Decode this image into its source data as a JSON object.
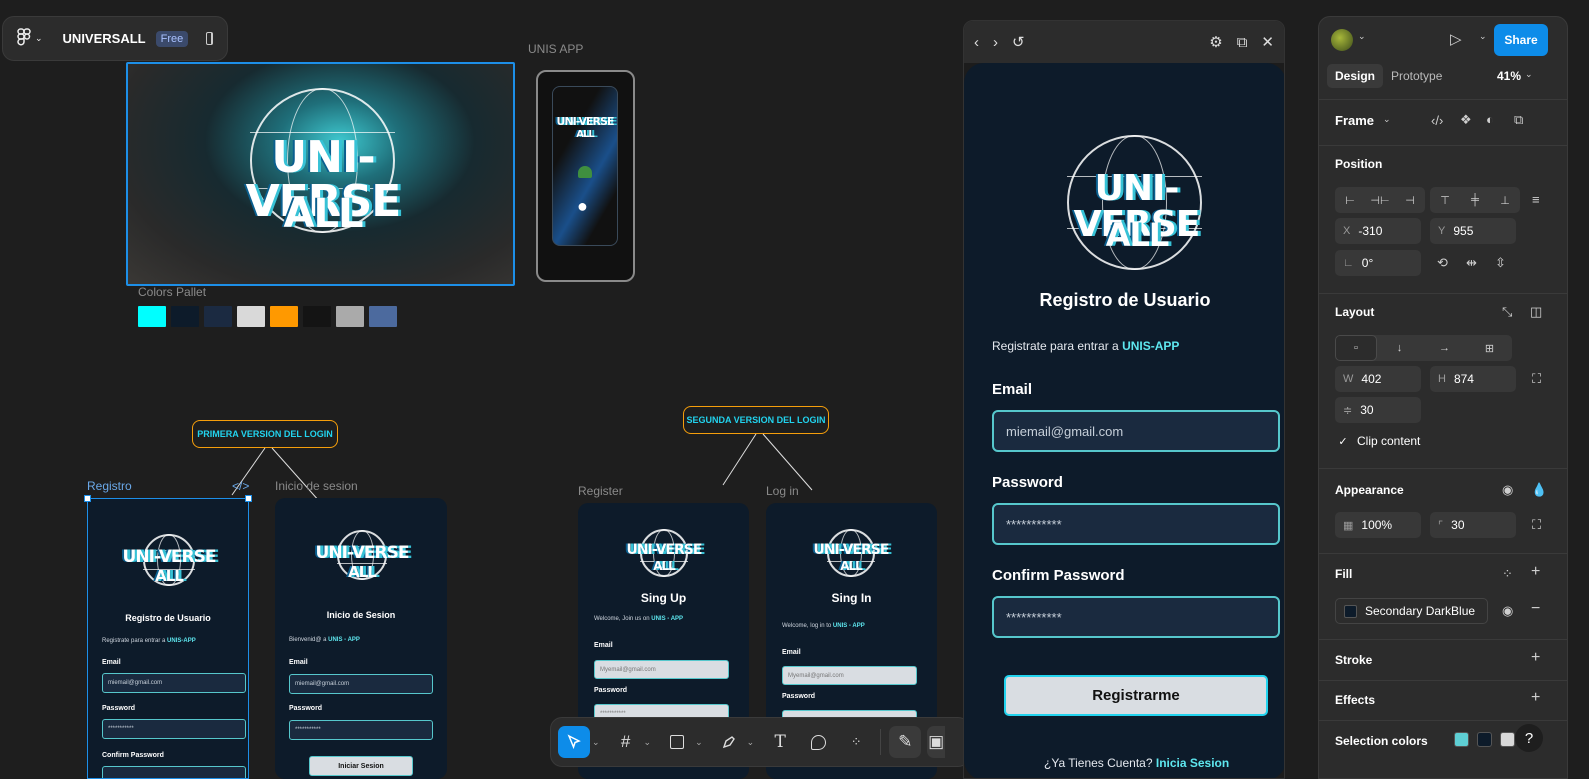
{
  "menu": {
    "project_name": "UNIVERSALL",
    "plan_badge": "Free"
  },
  "canvas": {
    "hero_brand_line1": "UNI-VERSE",
    "hero_brand_line2": "ALL",
    "phone_label": "UNIS APP",
    "colors_label": "Colors Pallet",
    "palette": [
      "#00ffff",
      "#0d1b2a",
      "#1b2a41",
      "#d9d9d9",
      "#ff9900",
      "#141414",
      "#aaaaaa",
      "#4c6a9e"
    ],
    "callout1": "PRIMERA VERSION DEL LOGIN",
    "callout2": "SEGUNDA VERSION DEL LOGIN",
    "frame_registro": "Registro",
    "frame_inicio": "Inicio de sesion",
    "frame_register": "Register",
    "frame_login": "Log in",
    "code_icon": "</>",
    "registro_screen": {
      "title": "Registro de Usuario",
      "subtitle": "Registrate para entrar a",
      "app": "UNIS-APP",
      "email_label": "Email",
      "email_value": "miemail@gmail.com",
      "password_label": "Password",
      "password_value": "***********",
      "confirm_label": "Confirm Password"
    },
    "inicio_screen": {
      "title": "Inicio de Sesion",
      "subtitle": "Bienvenid@  a",
      "app": "UNIS - APP",
      "email_label": "Email",
      "email_value": "miemail@gmail.com",
      "password_label": "Password",
      "password_value": "***********",
      "button": "Iniciar Sesion"
    },
    "register_screen": {
      "title": "Sing Up",
      "subtitle": "Welcome, Join us on",
      "app": "UNIS - APP",
      "email_label": "Email",
      "email_value": "Myemail@gmail.com",
      "password_label": "Password",
      "password_value": "***********"
    },
    "login_screen": {
      "title": "Sing In",
      "subtitle": "Welcome, log in to",
      "app": "UNIS - APP",
      "email_label": "Email",
      "email_value": "Myemail@gmail.com",
      "password_label": "Password"
    }
  },
  "preview": {
    "brand_line1": "UNI-VERSE",
    "brand_line2": "ALL",
    "title": "Registro de Usuario",
    "subtitle": "Registrate para entrar a",
    "app": "UNIS-APP",
    "email_label": "Email",
    "email_value": "miemail@gmail.com",
    "password_label": "Password",
    "password_value": "***********",
    "confirm_label": "Confirm Password",
    "confirm_value": "***********",
    "button": "Registrarme",
    "footer_text": "¿Ya Tienes Cuenta?",
    "footer_link": "Inicia Sesion"
  },
  "panel": {
    "share": "Share",
    "tab_design": "Design",
    "tab_prototype": "Prototype",
    "zoom": "41%",
    "frame_type": "Frame",
    "position_title": "Position",
    "x_key": "X",
    "x_value": "-310",
    "y_key": "Y",
    "y_value": "955",
    "rotation": "0°",
    "layout_title": "Layout",
    "w_key": "W",
    "w_value": "402",
    "h_key": "H",
    "h_value": "874",
    "gap_value": "30",
    "clip_content": "Clip content",
    "appearance_title": "Appearance",
    "opacity": "100%",
    "radius": "30",
    "fill_title": "Fill",
    "fill_name": "Secondary DarkBlue",
    "stroke_title": "Stroke",
    "effects_title": "Effects",
    "selection_colors_title": "Selection colors",
    "selection_colors": [
      "#5ecfd4",
      "#0d1b2a",
      "#d9d9d9"
    ],
    "help": "?"
  }
}
